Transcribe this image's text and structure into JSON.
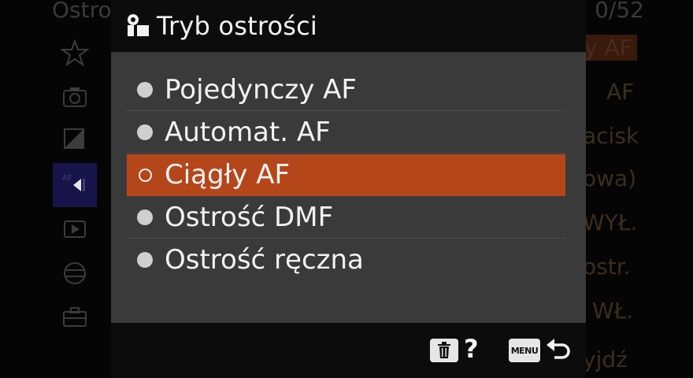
{
  "background_menu": {
    "title": "Ostro",
    "page": "0/52",
    "tabs": [
      {
        "icon": "star-icon",
        "active": false
      },
      {
        "icon": "camera-icon",
        "active": false
      },
      {
        "icon": "exposure-icon",
        "active": false
      },
      {
        "icon": "af-tab-icon",
        "active": true
      },
      {
        "icon": "playback-icon",
        "active": false
      },
      {
        "icon": "network-icon",
        "active": false
      },
      {
        "icon": "toolbox-icon",
        "active": false
      }
    ],
    "values": [
      {
        "text": "y AF",
        "selected": true
      },
      {
        "text": "AF",
        "selected": false
      },
      {
        "text": "acisk",
        "selected": false
      },
      {
        "text": "owa)",
        "selected": false
      },
      {
        "text": "WYŁ.",
        "selected": false
      },
      {
        "text": "ostr.",
        "selected": false
      },
      {
        "text": "WŁ.",
        "selected": false
      },
      {
        "text": "yjdź",
        "selected": false
      }
    ]
  },
  "popup": {
    "title": "Tryb ostrości",
    "options": [
      {
        "label": "Pojedynczy AF",
        "selected": false
      },
      {
        "label": "Automat. AF",
        "selected": false
      },
      {
        "label": "Ciągły AF",
        "selected": true
      },
      {
        "label": "Ostrość DMF",
        "selected": false
      },
      {
        "label": "Ostrość ręczna",
        "selected": false
      }
    ],
    "footer": {
      "help_mark": "?",
      "menu_label": "MENU"
    }
  },
  "colors": {
    "selected_highlight": "#b5461a",
    "panel": "#3a3a3a",
    "bar": "#0c0c0c",
    "active_tab": "#17144a"
  }
}
